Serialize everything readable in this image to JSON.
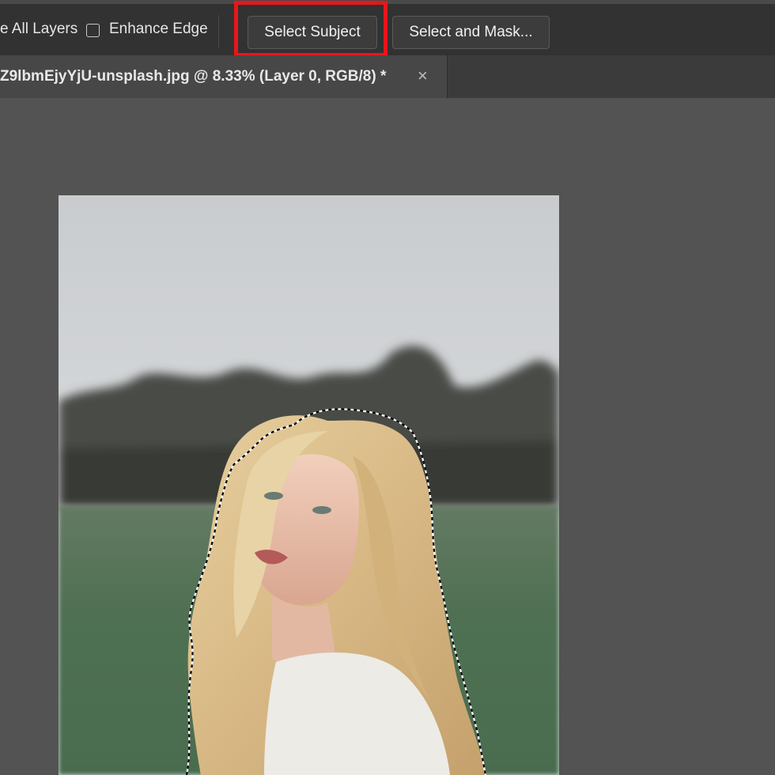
{
  "options_bar": {
    "sample_all_layers_label": "e All Layers",
    "enhance_edge_label": "Enhance Edge",
    "enhance_edge_checked": false,
    "select_subject_label": "Select Subject",
    "select_and_mask_label": "Select and Mask..."
  },
  "document_tab": {
    "title": "Z9lbmEjyYjU-unsplash.jpg @ 8.33% (Layer 0, RGB/8) *",
    "close_glyph": "×"
  },
  "colors": {
    "options_bar_bg": "#323232",
    "workspace_bg": "#535353",
    "highlight_box": "#e8161b"
  },
  "icons": {
    "tab_close": "close-icon",
    "checkbox": "checkbox-icon"
  }
}
